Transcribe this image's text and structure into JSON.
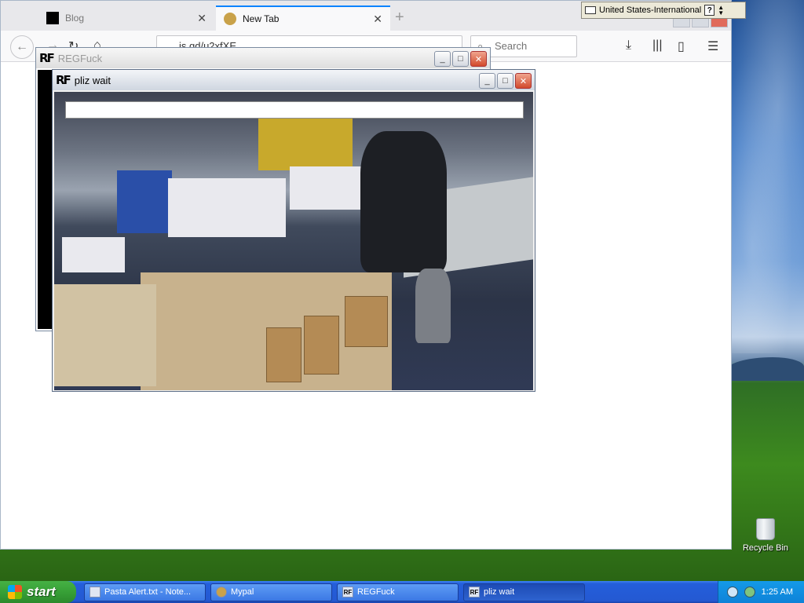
{
  "browser": {
    "tabs": [
      {
        "label": "Blog",
        "active": false
      },
      {
        "label": "New Tab",
        "active": true
      }
    ],
    "url": "is.gd/u2xfXE",
    "search_placeholder": "Search"
  },
  "windows": {
    "regfuck": {
      "title": "REGFuck"
    },
    "pliz": {
      "title": "pliz wait",
      "progress": 0
    }
  },
  "langbar": {
    "language": "United States-International",
    "help": "?"
  },
  "desktop": {
    "recycle_bin": "Recycle Bin"
  },
  "taskbar": {
    "start_label": "start",
    "tasks": [
      {
        "label": "Pasta Alert.txt - Note..."
      },
      {
        "label": "Mypal"
      },
      {
        "label": "REGFuck"
      },
      {
        "label": "pliz wait"
      }
    ],
    "clock": "1:25 AM"
  },
  "colors": {
    "accent": "#0a84ff",
    "taskbar": "#245edb",
    "start": "#37a037"
  }
}
